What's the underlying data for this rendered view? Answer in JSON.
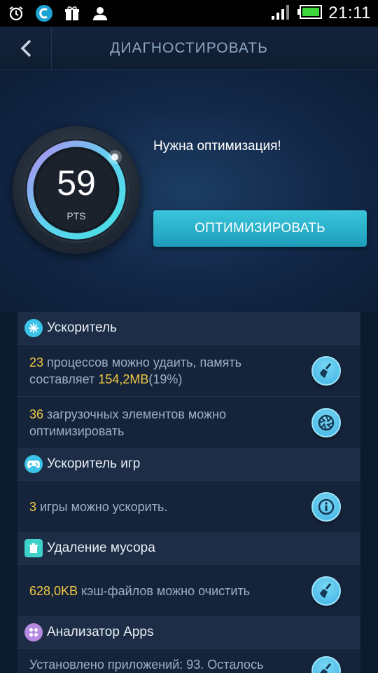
{
  "status_bar": {
    "time": "21:11",
    "icons": [
      "alarm-icon",
      "app-c-icon",
      "gift-icon",
      "person-icon",
      "signal-icon",
      "battery-icon"
    ]
  },
  "header": {
    "title": "ДИАГНОСТИРОВАТЬ",
    "back_icon": "chevron-left-icon"
  },
  "hero": {
    "score": "59",
    "unit": "PTS",
    "score_fraction": 0.59,
    "message": "Нужна оптимизация!",
    "optimize_label": "ОПТИМИЗИРОВАТЬ"
  },
  "sections": {
    "booster": {
      "title": "Ускоритель",
      "icon": "snowflake-icon",
      "icon_color": "#3bc4e8",
      "processes": {
        "count": "23",
        "text_a": " процессов можно удаить, память составляет ",
        "size": "154,2MB",
        "text_b": "(19%)"
      },
      "startup": {
        "count": "36",
        "text": " загрузочных элементов можно оптимизировать"
      }
    },
    "game": {
      "title": "Ускоритель игр",
      "icon": "gamepad-icon",
      "icon_color": "#3bc4e8",
      "row": {
        "count": "3",
        "text": " игры можно ускорить."
      }
    },
    "junk": {
      "title": "Удаление мусора",
      "icon": "trash-icon",
      "icon_color": "#3ed0c9",
      "row": {
        "size": "628,0KB",
        "text": " кэш-файлов можно очистить"
      }
    },
    "apps": {
      "title": "Анализатор Apps",
      "icon": "apps-icon",
      "icon_color": "#b58ae0",
      "row": {
        "text": "Установлено приложений: 93. Осталось"
      }
    }
  },
  "colors": {
    "accent": "#2bb0cd",
    "highlight": "#f3c843"
  }
}
